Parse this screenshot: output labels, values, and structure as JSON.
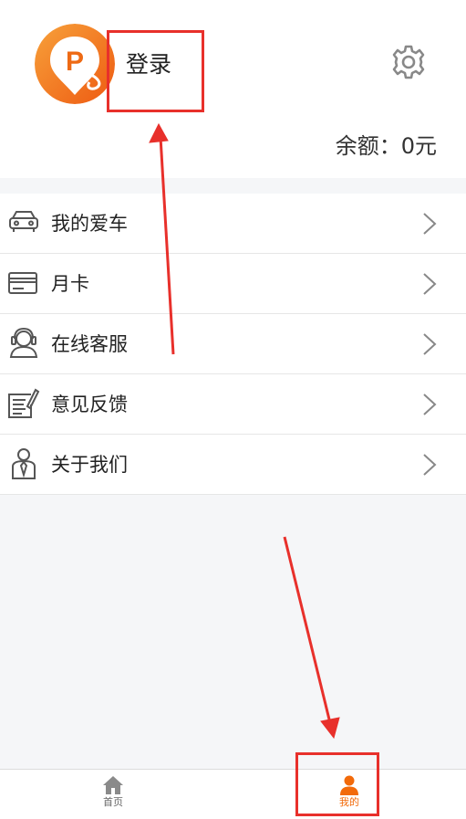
{
  "profile": {
    "login_label": "登录",
    "balance_label": "余额：",
    "balance_value": "0元"
  },
  "menu": {
    "items": [
      {
        "label": "我的爱车",
        "icon": "car-icon"
      },
      {
        "label": "月卡",
        "icon": "card-icon"
      },
      {
        "label": "在线客服",
        "icon": "headset-user-icon"
      },
      {
        "label": "意见反馈",
        "icon": "feedback-note-icon"
      },
      {
        "label": "关于我们",
        "icon": "person-tie-icon"
      }
    ]
  },
  "tabbar": {
    "tabs": [
      {
        "label": "首页",
        "icon": "home-icon",
        "active": false
      },
      {
        "label": "我的",
        "icon": "user-icon",
        "active": true
      }
    ]
  },
  "colors": {
    "accent": "#f26a0a",
    "annotation": "#e8302b",
    "background": "#f5f6f8"
  }
}
